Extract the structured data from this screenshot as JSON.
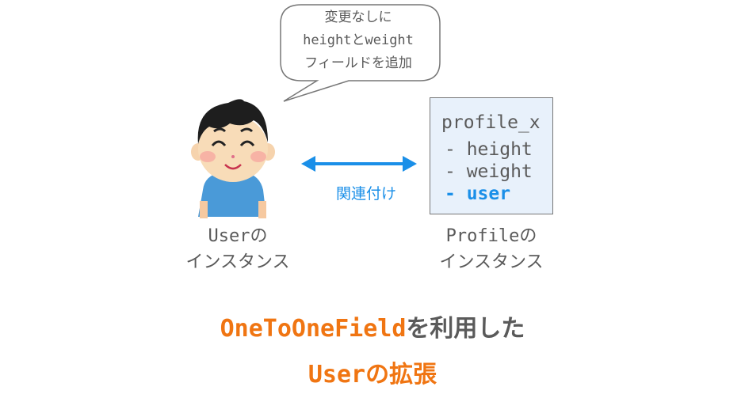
{
  "speech_bubble": {
    "lines": [
      "変更なしに",
      "heightとweight",
      "フィールドを追加"
    ]
  },
  "profile_instance": {
    "name": "profile_x",
    "fields": [
      {
        "text": "- height",
        "highlighted": false
      },
      {
        "text": "- weight",
        "highlighted": false
      },
      {
        "text": "- user",
        "highlighted": true
      }
    ],
    "label_line1": "Profileの",
    "label_line2": "インスタンス"
  },
  "user_instance": {
    "label_line1": "Userの",
    "label_line2": "インスタンス",
    "icon": "smiling-boy-illustration"
  },
  "relation": {
    "label": "関連付け",
    "icon": "double-arrow-icon"
  },
  "title": {
    "line1_highlight": "OneToOneField",
    "line1_rest": "を利用した",
    "line2": "Userの拡張"
  },
  "colors": {
    "accent_blue": "#1a8fe8",
    "accent_orange": "#f07512",
    "text_gray": "#5a5a5a",
    "box_fill": "#e8f1fb"
  }
}
